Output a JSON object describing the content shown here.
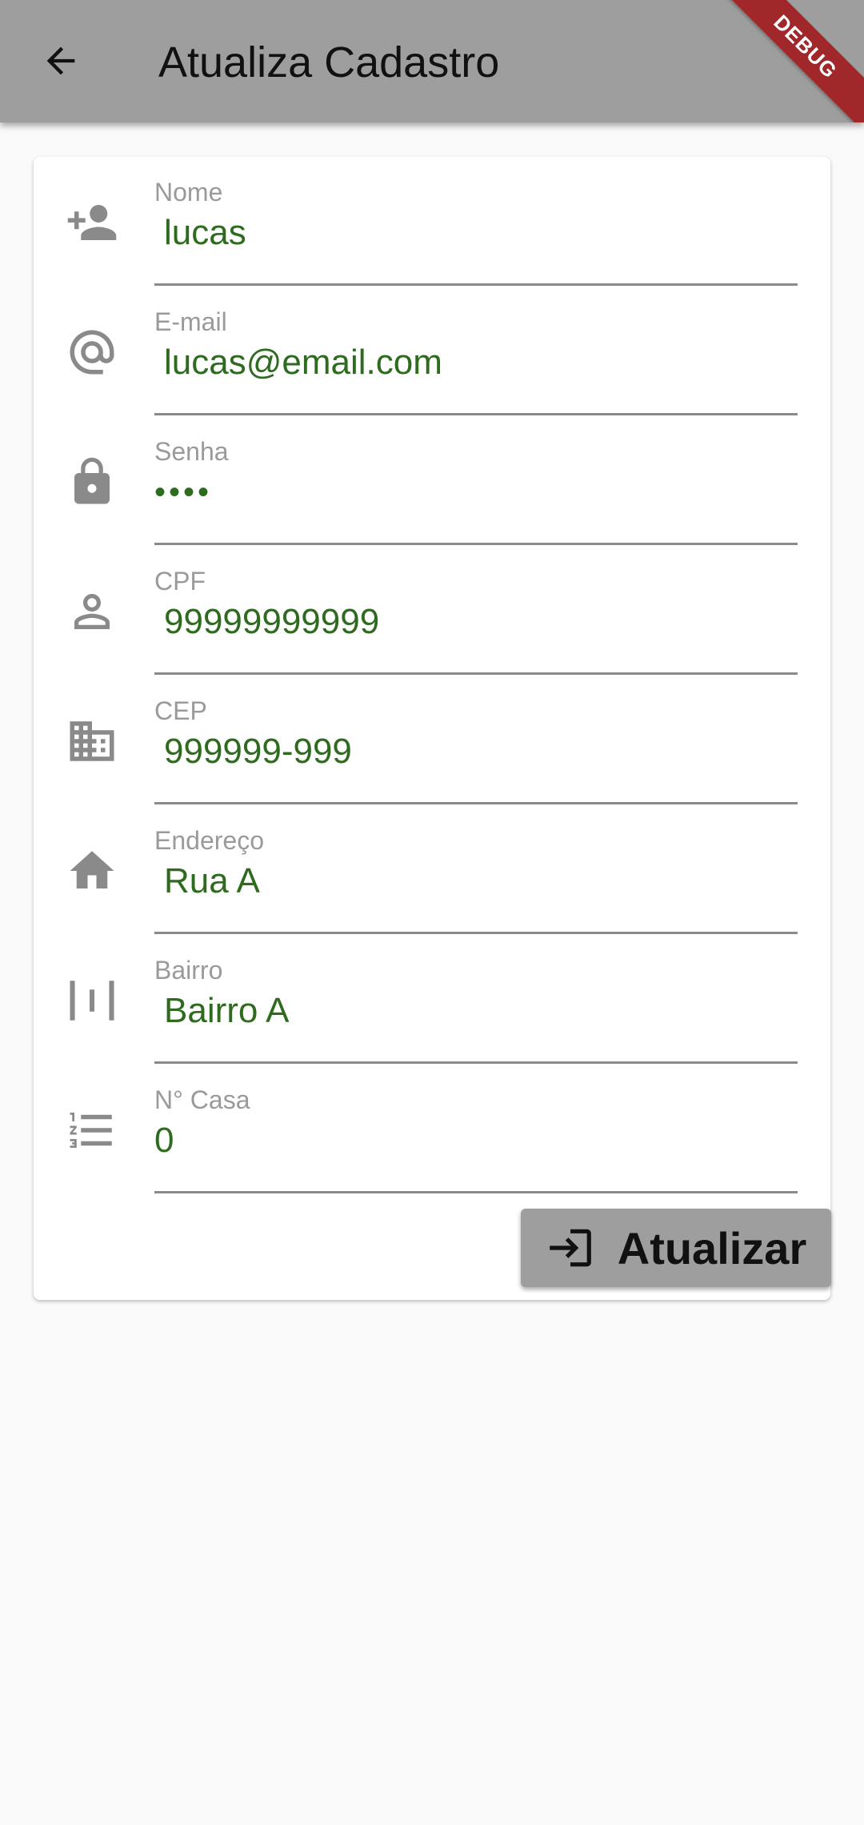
{
  "appbar": {
    "title": "Atualiza Cadastro",
    "back_icon": "arrow-back-icon",
    "debug_banner": "DEBUG"
  },
  "form": {
    "fields": [
      {
        "label": "Nome",
        "value": "lucas",
        "icon": "person-add-icon"
      },
      {
        "label": "E-mail",
        "value": "lucas@email.com",
        "icon": "at-sign-icon"
      },
      {
        "label": "Senha",
        "value": "••••",
        "icon": "lock-icon"
      },
      {
        "label": "CPF",
        "value": "99999999999",
        "icon": "person-outline-icon"
      },
      {
        "label": "CEP",
        "value": "999999-999",
        "icon": "business-icon"
      },
      {
        "label": "Endereço",
        "value": "Rua A",
        "icon": "home-icon"
      },
      {
        "label": "Bairro",
        "value": "Bairro A",
        "icon": "view-week-icon"
      },
      {
        "label": "N° Casa",
        "value": "0",
        "icon": "format-list-numbered-icon"
      }
    ],
    "submit_label": "Atualizar",
    "submit_icon": "login-icon"
  },
  "colors": {
    "appbar": "#9e9e9e",
    "value_text": "#2e6b1f",
    "label_text": "#9a9a9a",
    "icon": "#8a8a8a",
    "debug_banner": "#a0282a"
  }
}
